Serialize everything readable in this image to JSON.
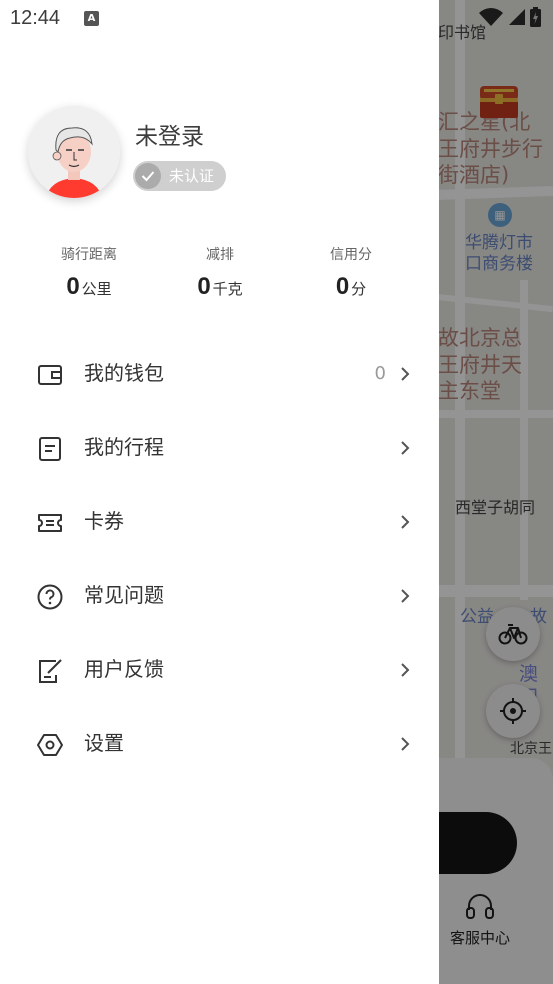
{
  "status_bar": {
    "time": "12:44",
    "a_badge": "A"
  },
  "profile": {
    "username": "未登录",
    "verify_label": "未认证"
  },
  "stats": [
    {
      "label": "骑行距离",
      "value": "0",
      "unit": "公里"
    },
    {
      "label": "减排",
      "value": "0",
      "unit": "千克"
    },
    {
      "label": "信用分",
      "value": "0",
      "unit": "分"
    }
  ],
  "menu": [
    {
      "label": "我的钱包",
      "icon": "wallet-icon",
      "count": "0"
    },
    {
      "label": "我的行程",
      "icon": "trip-list-icon"
    },
    {
      "label": "卡券",
      "icon": "coupon-icon"
    },
    {
      "label": "常见问题",
      "icon": "question-icon"
    },
    {
      "label": "用户反馈",
      "icon": "feedback-icon"
    },
    {
      "label": "设置",
      "icon": "settings-hex-icon"
    }
  ],
  "map": {
    "labels": [
      "印书馆",
      "汇之星(北",
      "王府井步行",
      "街酒店)",
      "华腾灯市",
      "口商务楼",
      "故北京总",
      "王府井天",
      "主东堂",
      "西堂子胡同",
      "公益",
      "故",
      "澳门",
      "北京王"
    ]
  },
  "bottom": {
    "service_label": "客服中心"
  },
  "colors": {
    "accent": "#ff3b2f",
    "badge_bg": "#cfcfcf",
    "text": "#333333"
  }
}
